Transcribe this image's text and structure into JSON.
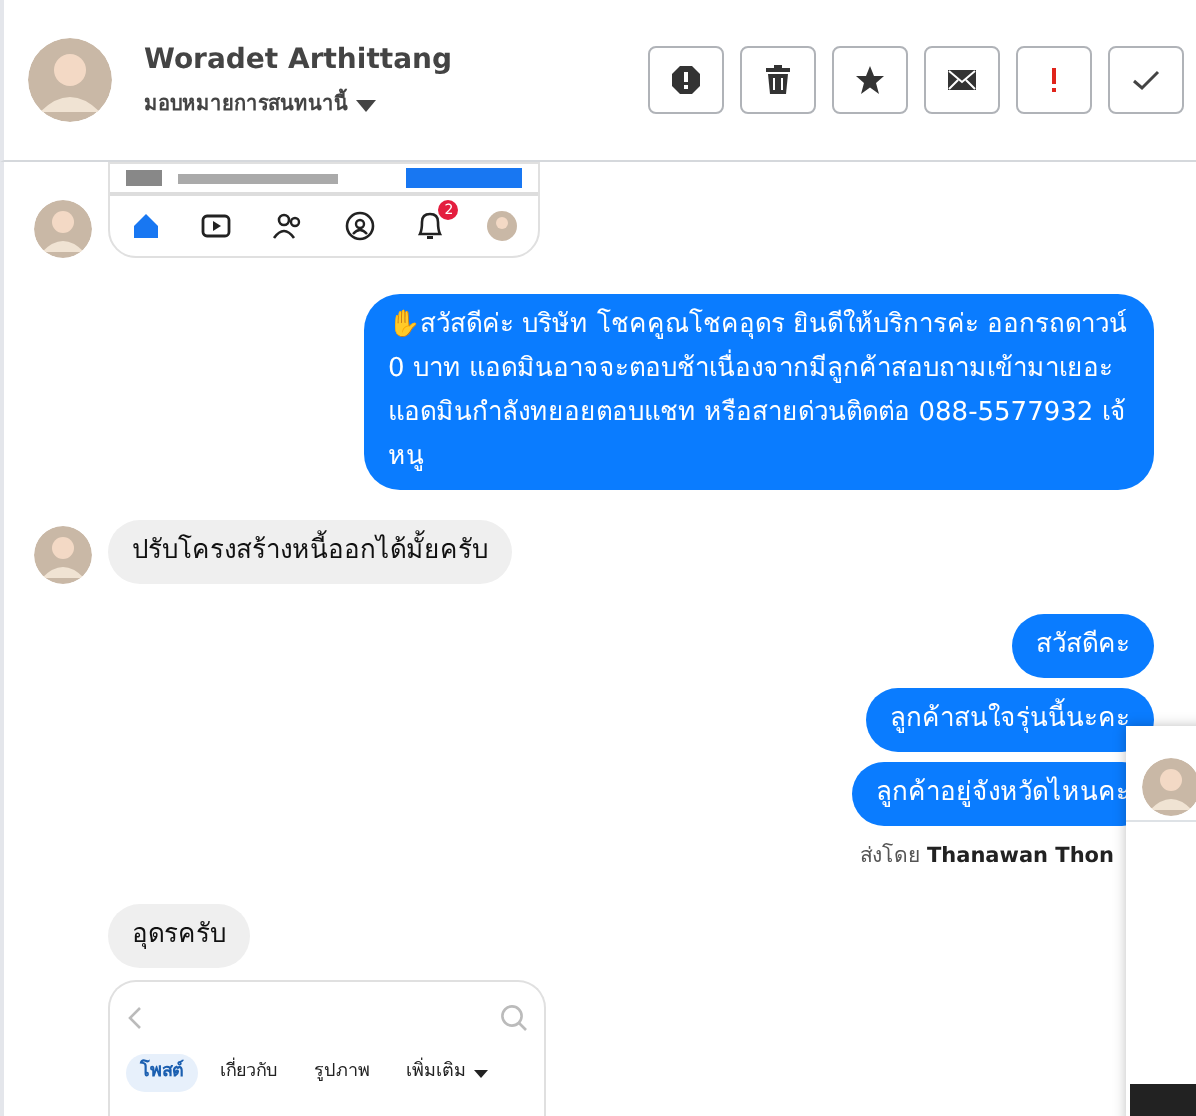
{
  "header": {
    "name": "Woradet Arthittang",
    "assign_label": "มอบหมายการสนทนานี้",
    "actions": [
      {
        "kind": "spam"
      },
      {
        "kind": "delete"
      },
      {
        "kind": "star"
      },
      {
        "kind": "unread"
      },
      {
        "kind": "important"
      },
      {
        "kind": "done"
      }
    ]
  },
  "messages": [
    {
      "kind": "tabbar-shot",
      "avatar": true,
      "badge": "2"
    },
    {
      "kind": "outgoing",
      "text": "✋สวัสดีค่ะ บริษัท โชคคูณโชคอุดร ยินดีให้บริการค่ะ ออกรถดาวน์ 0 บาท แอดมินอาจจะตอบช้าเนื่องจากมีลูกค้าสอบถามเข้ามาเยอะ แอดมินกำลังทยอยตอบแชท หรือสายด่วนติดต่อ 088-5577932 เจ้หนู"
    },
    {
      "kind": "incoming",
      "avatar": true,
      "text": "ปรับโครงสร้างหนี้ออกได้มั้ยครับ"
    },
    {
      "kind": "outgoing",
      "text": "สวัสดีคะ"
    },
    {
      "kind": "outgoing",
      "text": "ลูกค้าสนใจรุ่นนี้นะคะ"
    },
    {
      "kind": "outgoing",
      "text": "ลูกค้าอยู่จังหวัดไหนคะ"
    },
    {
      "kind": "sender",
      "label": "ส่งโดย",
      "name": "Thanawan Thon"
    },
    {
      "kind": "incoming",
      "avatar": false,
      "text": "อุดรครับ"
    },
    {
      "kind": "profile-shot",
      "avatar": false,
      "tabs": [
        {
          "label": "โพสต์",
          "selected": true
        },
        {
          "label": "เกี่ยวกับ",
          "selected": false
        },
        {
          "label": "รูปภาพ",
          "selected": false
        },
        {
          "label": "เพิ่มเติม",
          "selected": false
        }
      ]
    }
  ]
}
